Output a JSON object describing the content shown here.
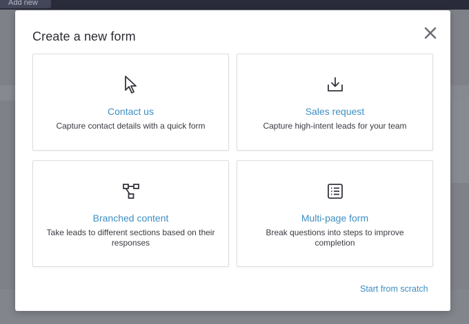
{
  "background": {
    "add_new_label": "Add new"
  },
  "modal": {
    "title": "Create a new form",
    "close_icon": "close-icon",
    "cards": [
      {
        "icon": "cursor-arrow-icon",
        "title": "Contact us",
        "description": "Capture contact details with a quick form"
      },
      {
        "icon": "download-tray-icon",
        "title": "Sales request",
        "description": "Capture high-intent leads for your team"
      },
      {
        "icon": "branch-nodes-icon",
        "title": "Branched content",
        "description": "Take leads to different sections based on their responses"
      },
      {
        "icon": "list-document-icon",
        "title": "Multi-page form",
        "description": "Break questions into steps to improve completion"
      }
    ],
    "start_from_scratch": "Start from scratch"
  },
  "colors": {
    "accent_link": "#3c8ec2",
    "overlay": "#7f8189",
    "title_text": "#2b2b33"
  }
}
